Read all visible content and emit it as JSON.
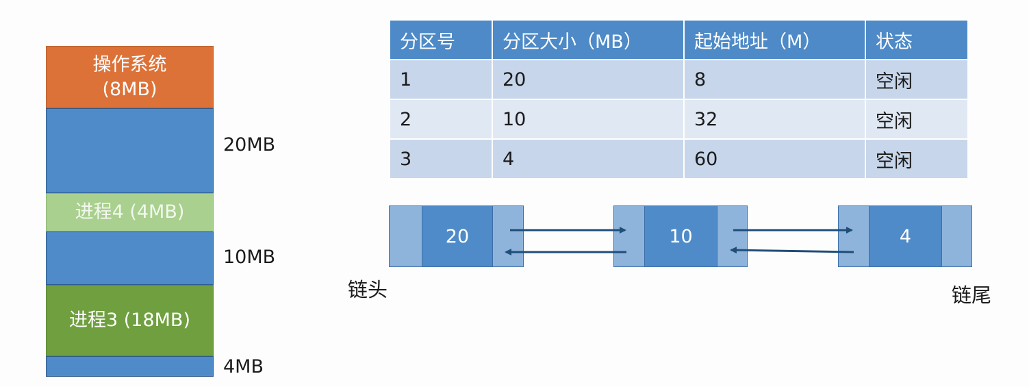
{
  "memory": {
    "os_label": "操作系统",
    "os_size": "(8MB)",
    "p4_label": "进程4 (4MB)",
    "p3_label": "进程3 (18MB)",
    "size_labels": [
      "20MB",
      "10MB",
      "4MB"
    ]
  },
  "table": {
    "headers": [
      "分区号",
      "分区大小（MB）",
      "起始地址（M）",
      "状态"
    ],
    "rows": [
      [
        "1",
        "20",
        "8",
        "空闲"
      ],
      [
        "2",
        "10",
        "32",
        "空闲"
      ],
      [
        "3",
        "4",
        "60",
        "空闲"
      ]
    ]
  },
  "list": {
    "nodes": [
      "20",
      "10",
      "4"
    ],
    "head_label": "链头",
    "tail_label": "链尾"
  },
  "colors": {
    "os": "#dd7238",
    "free": "#4f8bc8",
    "process4": "#a9d08e",
    "process3": "#6f9f3f",
    "table_header": "#4d8ac7",
    "arrow": "#1f4e79"
  }
}
